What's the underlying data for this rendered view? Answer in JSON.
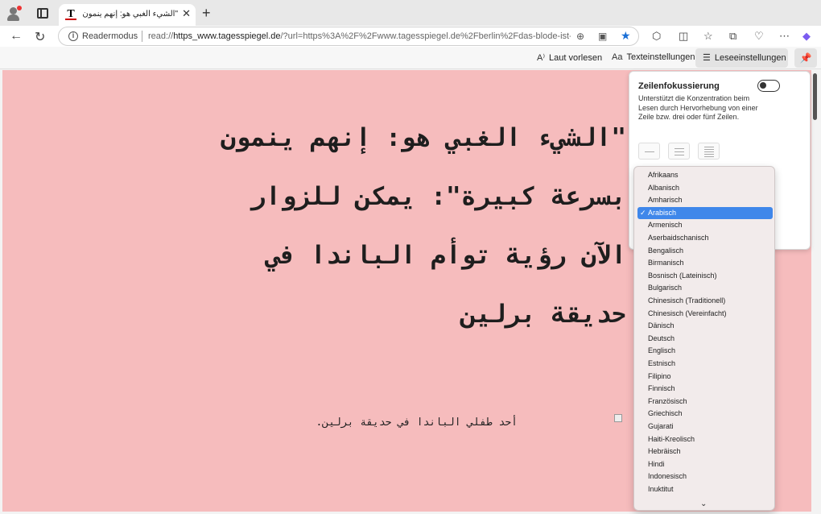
{
  "browser": {
    "tab": {
      "title": "\"الشيء الغبي هو: إنهم ينمون بسرعة",
      "favicon": "T",
      "close": "✕"
    },
    "new_tab": "+",
    "nav": {
      "back": "←",
      "reload": "↻"
    },
    "address": {
      "mode": "Readermodus",
      "url_prefix": "read://",
      "url_host": "https_www.tagesspiegel.de",
      "url_rest": "/?url=https%3A%2F%2Fwww.tagesspiegel.de%2Fberlin%2Fdas-blode-ist-..."
    }
  },
  "reader_toolbar": {
    "read_aloud": "Laut vorlesen",
    "text_settings": "Texteinstellungen",
    "reading_settings": "Leseeinstellungen"
  },
  "article": {
    "headline": "\"الشيء الغبي هو: إنهم ينمون بسرعة كبيرة\": يمكن للزوار الآن رؤية توأم الباندا في حديقة برلين",
    "caption": "أحد طفلي الباندا في حديقة برلين.",
    "background": "#f6bcbd"
  },
  "panel": {
    "title": "Zeilenfokussierung",
    "description": "Unterstützt die Konzentration beim Lesen durch Hervorhebung von einer Zeile bzw. drei oder fünf Zeilen.",
    "toggle_on": false
  },
  "language_dropdown": {
    "selected": "Arabisch",
    "options": [
      "Afrikaans",
      "Albanisch",
      "Amharisch",
      "Arabisch",
      "Armenisch",
      "Aserbaidschanisch",
      "Bengalisch",
      "Birmanisch",
      "Bosnisch (Lateinisch)",
      "Bulgarisch",
      "Chinesisch (Traditionell)",
      "Chinesisch (Vereinfacht)",
      "Dänisch",
      "Deutsch",
      "Englisch",
      "Estnisch",
      "Filipino",
      "Finnisch",
      "Französisch",
      "Griechisch",
      "Gujarati",
      "Haiti-Kreolisch",
      "Hebräisch",
      "Hindi",
      "Indonesisch",
      "Inuktitut"
    ],
    "accent": "#3f87ea"
  }
}
